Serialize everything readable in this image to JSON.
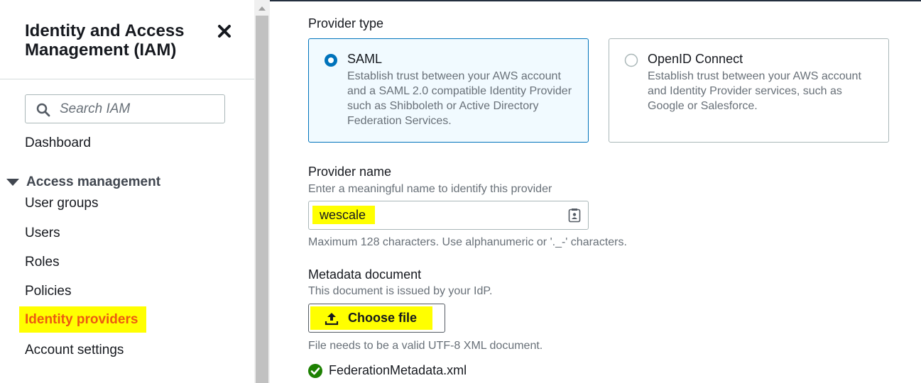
{
  "sidebar": {
    "title": "Identity and Access Management (IAM)",
    "search_placeholder": "Search IAM",
    "dashboard": "Dashboard",
    "section_label": "Access management",
    "items": [
      {
        "label": "User groups"
      },
      {
        "label": "Users"
      },
      {
        "label": "Roles"
      },
      {
        "label": "Policies"
      },
      {
        "label": "Identity providers",
        "active": true
      },
      {
        "label": "Account settings"
      }
    ]
  },
  "main": {
    "provider_type": {
      "label": "Provider type",
      "options": [
        {
          "title": "SAML",
          "description": "Establish trust between your AWS account and a SAML 2.0 compatible Identity Provider such as Shibboleth or Active Directory Federation Services.",
          "selected": true
        },
        {
          "title": "OpenID Connect",
          "description": "Establish trust between your AWS account and Identity Provider services, such as Google or Salesforce.",
          "selected": false
        }
      ]
    },
    "provider_name": {
      "label": "Provider name",
      "description": "Enter a meaningful name to identify this provider",
      "value": "wescale",
      "constraint": "Maximum 128 characters. Use alphanumeric or '._-' characters."
    },
    "metadata": {
      "label": "Metadata document",
      "description": "This document is issued by your IdP.",
      "button_label": "Choose file",
      "constraint": "File needs to be a valid UTF-8 XML document.",
      "file_name": "FederationMetadata.xml"
    }
  },
  "colors": {
    "accent": "#0073bb",
    "highlight": "#ffff00",
    "active_nav": "#ec5a11",
    "success": "#1d8102"
  }
}
